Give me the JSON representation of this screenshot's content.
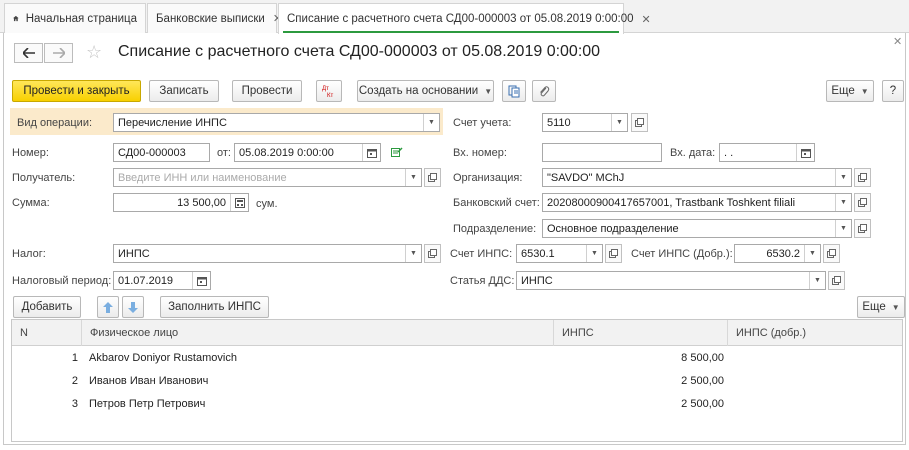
{
  "tabs": [
    {
      "label": "Начальная страница"
    },
    {
      "label": "Банковские выписки"
    },
    {
      "label": "Списание с расчетного счета СД00-000003 от 05.08.2019 0:00:00"
    }
  ],
  "title": "Списание с расчетного счета СД00-000003 от 05.08.2019 0:00:00",
  "toolbar": {
    "post_close": "Провести и закрыть",
    "save": "Записать",
    "post": "Провести",
    "dt_kt": "Дт Кт",
    "create_based": "Создать на основании",
    "more": "Еще",
    "help": "?"
  },
  "form": {
    "op_type_label": "Вид операции:",
    "op_type_value": "Перечисление ИНПС",
    "account_label": "Счет учета:",
    "account_value": "5110",
    "number_label": "Номер:",
    "number_value": "СД00-000003",
    "from_label": "от:",
    "date_value": "05.08.2019  0:00:00",
    "in_number_label": "Вх. номер:",
    "in_number_value": "",
    "in_date_label": "Вх. дата:",
    "in_date_value": "  .  .",
    "recipient_label": "Получатель:",
    "recipient_placeholder": "Введите ИНН или наименование",
    "org_label": "Организация:",
    "org_value": "\"SAVDO\" MChJ",
    "sum_label": "Сумма:",
    "sum_value": "13 500,00",
    "currency": "сум.",
    "bank_acc_label": "Банковский счет:",
    "bank_acc_value": "20208000900417657001, Trastbank Toshkent filiali",
    "division_label": "Подразделение:",
    "division_value": "Основное подразделение",
    "tax_label": "Налог:",
    "tax_value": "ИНПС",
    "inps_acc_label": "Счет ИНПС:",
    "inps_acc_value": "6530.1",
    "inps_add_label": "Счет ИНПС (Добр.):",
    "inps_add_value": "6530.2",
    "tax_period_label": "Налоговый период:",
    "tax_period_value": "01.07.2019",
    "dds_label": "Статья ДДС:",
    "dds_value": "ИНПС"
  },
  "table_toolbar": {
    "add": "Добавить",
    "fill": "Заполнить ИНПС",
    "more": "Еще"
  },
  "table": {
    "headers": [
      "N",
      "Физическое лицо",
      "ИНПС",
      "ИНПС (добр.)"
    ],
    "rows": [
      {
        "n": "1",
        "person": "Akbarov Doniyor Rustamovich",
        "inps": "8 500,00",
        "inps_add": ""
      },
      {
        "n": "2",
        "person": "Иванов Иван Иванович",
        "inps": "2 500,00",
        "inps_add": ""
      },
      {
        "n": "3",
        "person": "Петров Петр Петрович",
        "inps": "2 500,00",
        "inps_add": ""
      }
    ]
  },
  "colors": {
    "accent_green": "#2c9a3f",
    "primary_yellow": "#f8d000",
    "highlight": "#fbeacb"
  }
}
